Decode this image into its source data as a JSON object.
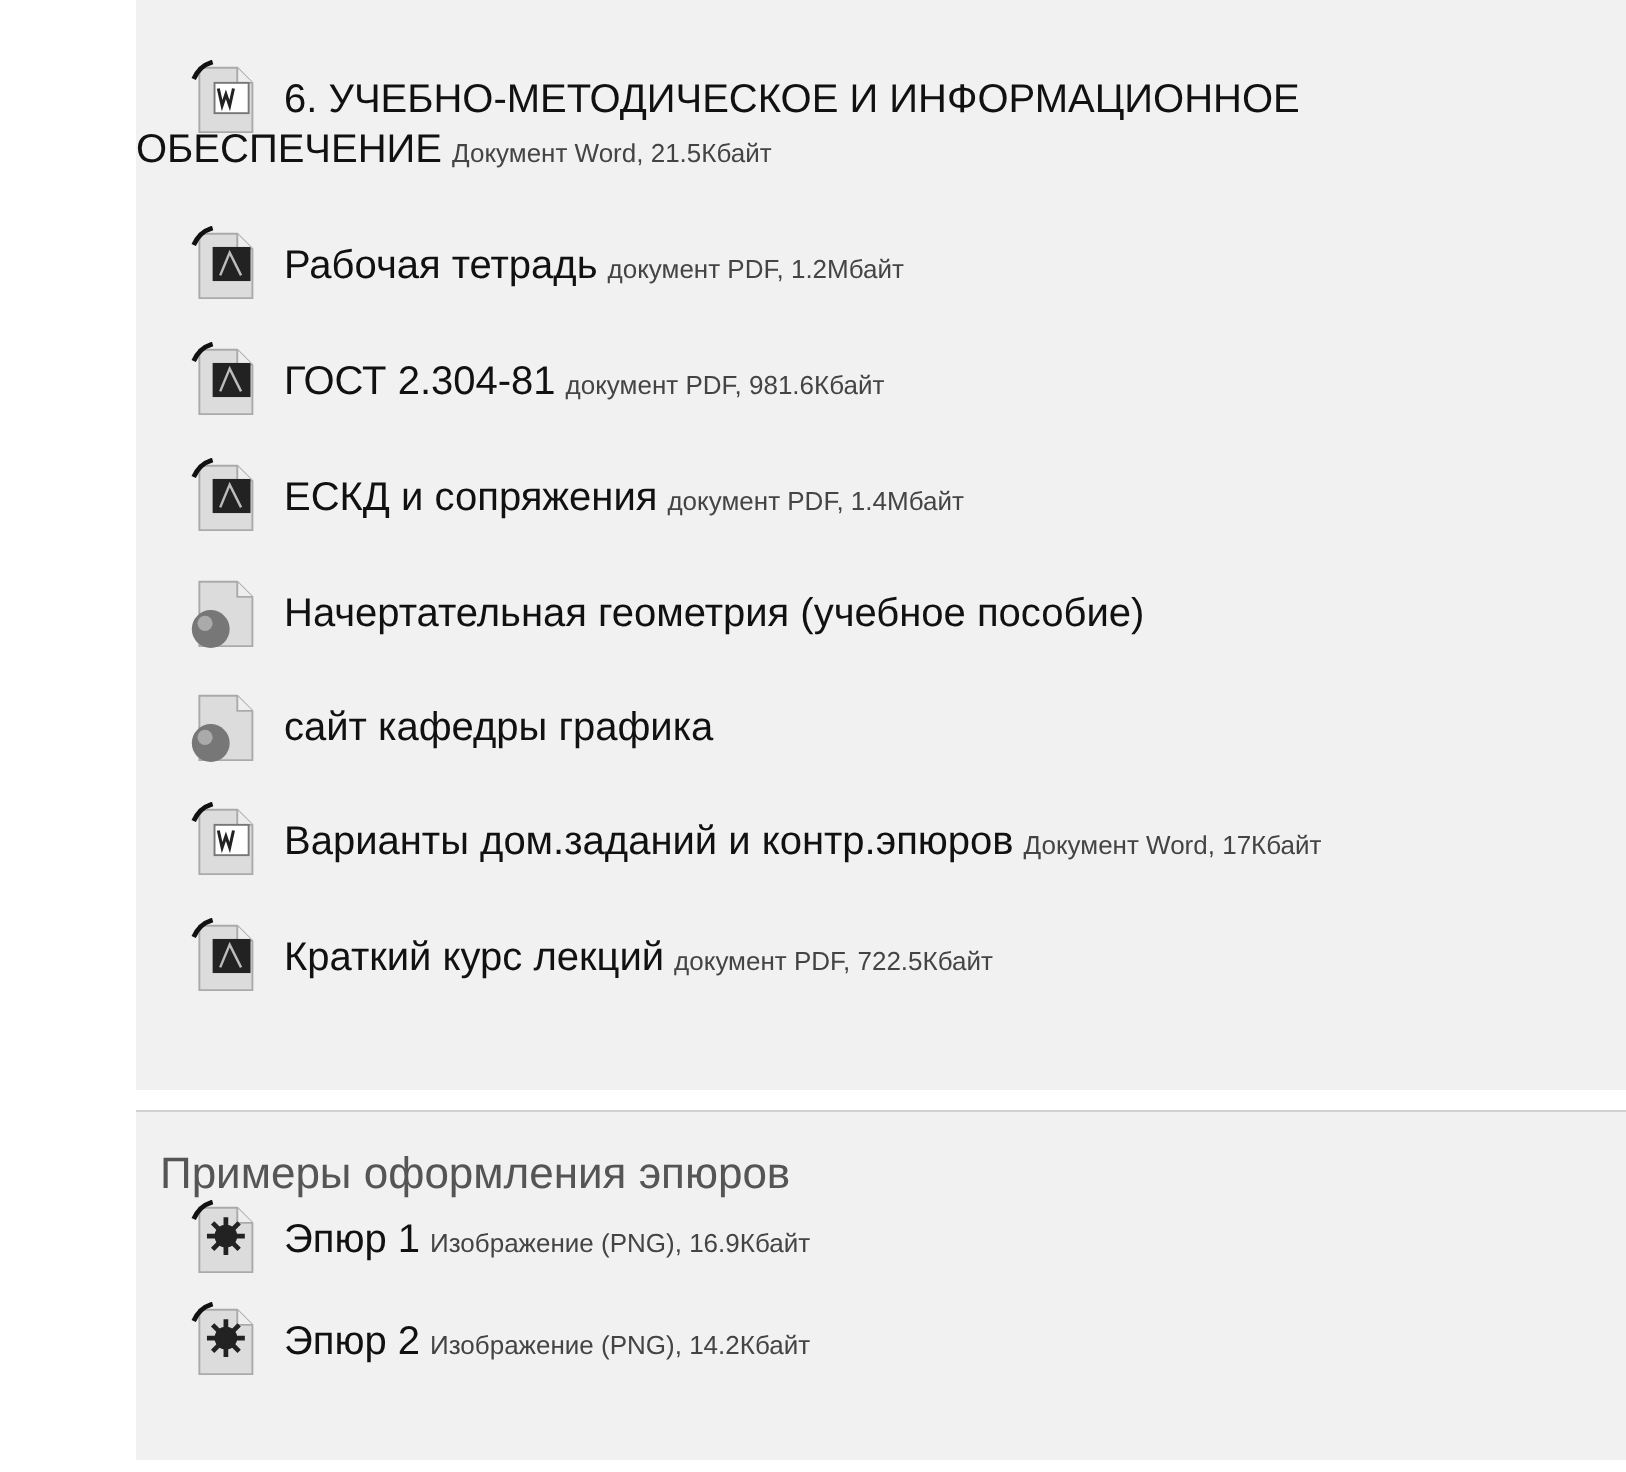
{
  "sections": [
    {
      "items": [
        {
          "kind": "word",
          "title": "6. УЧЕБНО-МЕТОДИЧЕСКОЕ И ИНФОРМАЦИОННОЕ ОБЕСПЕЧЕНИЕ",
          "meta": "Документ Word, 21.5Кбайт"
        },
        {
          "kind": "pdf",
          "title": "Рабочая тетрадь",
          "meta": "документ PDF, 1.2Мбайт"
        },
        {
          "kind": "pdf",
          "title": "ГОСТ 2.304-81",
          "meta": "документ PDF, 981.6Кбайт"
        },
        {
          "kind": "pdf",
          "title": "ЕСКД и сопряжения",
          "meta": "документ PDF, 1.4Мбайт"
        },
        {
          "kind": "url",
          "title": "Начертательная геометрия (учебное пособие)"
        },
        {
          "kind": "url",
          "title": "сайт кафедры графика"
        },
        {
          "kind": "word",
          "title": "Варианты дом.заданий и контр.эпюров",
          "meta": "Документ Word, 17Кбайт"
        },
        {
          "kind": "pdf",
          "title": "Краткий курс лекций",
          "meta": "документ PDF, 722.5Кбайт"
        }
      ]
    },
    {
      "heading": "Примеры оформления эпюров",
      "items": [
        {
          "kind": "image",
          "title": "Эпюр 1",
          "meta": "Изображение (PNG), 16.9Кбайт"
        },
        {
          "kind": "image",
          "title": "Эпюр 2",
          "meta": "Изображение (PNG), 14.2Кбайт"
        }
      ]
    }
  ]
}
